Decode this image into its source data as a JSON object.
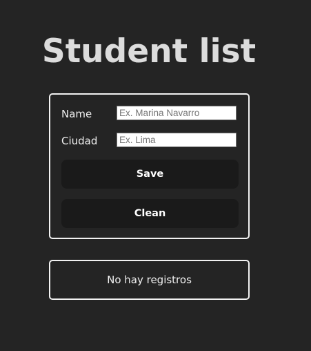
{
  "page": {
    "title": "Student list"
  },
  "form": {
    "name_label": "Name",
    "name_placeholder": "Ex. Marina Navarro",
    "name_value": "",
    "city_label": "Ciudad",
    "city_placeholder": "Ex. Lima",
    "city_value": "",
    "save_label": "Save",
    "clean_label": "Clean"
  },
  "list": {
    "empty_message": "No hay registros"
  },
  "colors": {
    "background": "#242424",
    "button_background": "#1a1a1a",
    "border": "#f2f2f2",
    "text": "#e6e6e6"
  }
}
